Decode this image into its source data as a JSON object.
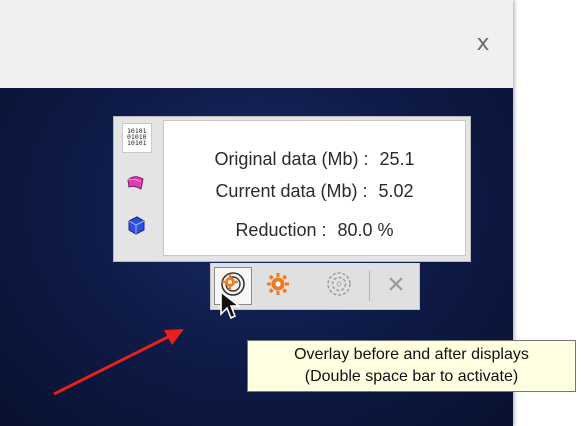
{
  "window": {
    "close_label": "x"
  },
  "stats": {
    "original_label": "Original data (Mb) :",
    "original_value": "25.1",
    "current_label": "Current data (Mb) :",
    "current_value": "5.02",
    "reduction_label": "Reduction :",
    "reduction_value": "80.0 %"
  },
  "side_icons": [
    "data-grid-icon",
    "surface-icon",
    "mesh-cube-icon"
  ],
  "toolbar": {
    "buttons": [
      "overlay-icon",
      "show-after-icon",
      "show-before-icon",
      "close-icon"
    ]
  },
  "tooltip": {
    "line1": "Overlay before and after displays",
    "line2": "(Double space bar to activate)"
  },
  "colors": {
    "viewport_bg": "#0f1c4a",
    "accent_orange": "#f07a20",
    "annotation_red": "#e8201c",
    "tooltip_bg": "#ffffe1"
  }
}
